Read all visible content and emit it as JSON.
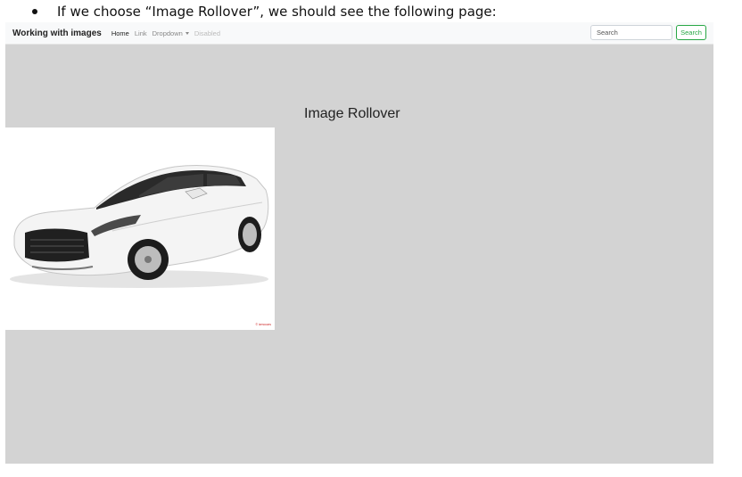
{
  "document": {
    "bullet_text": "If we choose “Image Rollover”, we should see the following page:"
  },
  "navbar": {
    "brand": "Working with images",
    "links": {
      "home": "Home",
      "link": "Link",
      "dropdown": "Dropdown",
      "disabled": "Disabled"
    },
    "search": {
      "placeholder": "Search",
      "button_label": "Search"
    }
  },
  "main": {
    "title": "Image Rollover",
    "image_watermark": "© izmocars"
  },
  "colors": {
    "page_background": "#d3d3d3",
    "navbar_background": "#f8f9fa",
    "search_button_accent": "#28a745"
  }
}
